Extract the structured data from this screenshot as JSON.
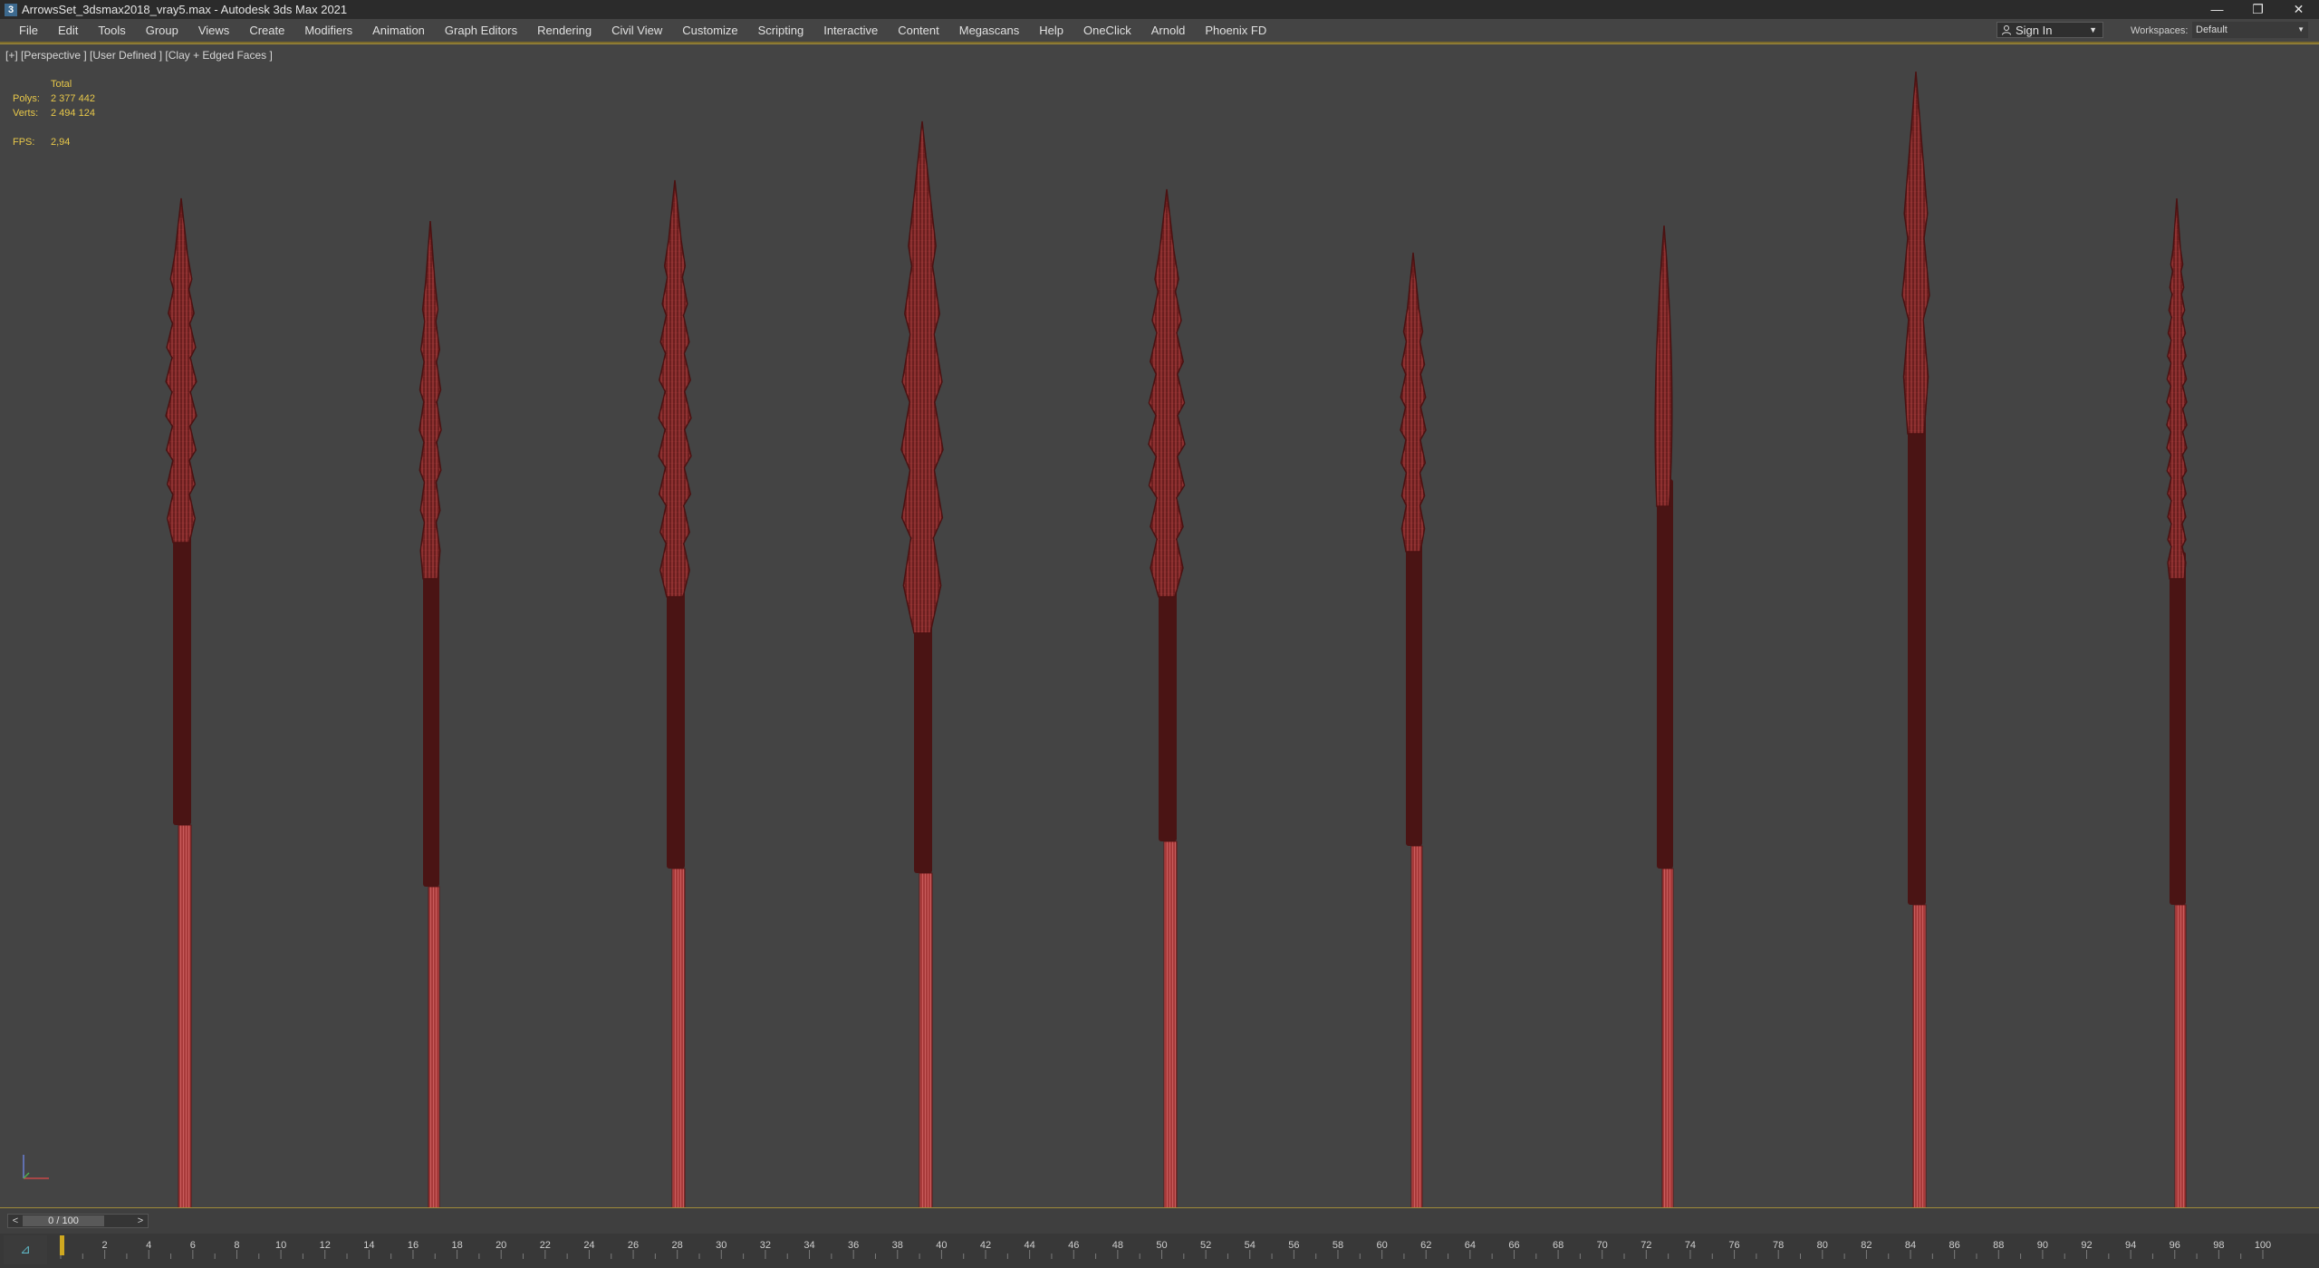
{
  "window": {
    "title": "ArrowsSet_3dsmax2018_vray5.max - Autodesk 3ds Max 2021",
    "icon": "3",
    "controls": [
      "minimize-icon",
      "restore-icon",
      "close-icon"
    ],
    "control_glyphs": {
      "minimize": "—",
      "restore": "❐",
      "close": "✕"
    }
  },
  "menu": [
    "File",
    "Edit",
    "Tools",
    "Group",
    "Views",
    "Create",
    "Modifiers",
    "Animation",
    "Graph Editors",
    "Rendering",
    "Civil View",
    "Customize",
    "Scripting",
    "Interactive",
    "Content",
    "Megascans",
    "Help",
    "OneClick",
    "Arnold",
    "Phoenix FD"
  ],
  "signin": {
    "icon": "user-icon",
    "label": "Sign In"
  },
  "workspaces": {
    "label": "Workspaces:",
    "value": "Default"
  },
  "viewport": {
    "label": "[+] [Perspective ] [User Defined ] [Clay + Edged Faces ]",
    "stats": {
      "header": "Total",
      "polys_label": "Polys:",
      "polys": "2 377 442",
      "verts_label": "Verts:",
      "verts": "2 494 124",
      "fps_label": "FPS:",
      "fps": "2,94"
    },
    "object_color": "#6b1f1f",
    "wire_color": "#c14a4a",
    "arrow_count": 9
  },
  "timeline": {
    "slider_label": "0 / 100",
    "prev": "<",
    "next": ">",
    "ticks": [
      "2",
      "4",
      "6",
      "8",
      "10",
      "12",
      "14",
      "16",
      "18",
      "20",
      "22",
      "24",
      "26",
      "28",
      "30",
      "32",
      "34",
      "36",
      "38",
      "40",
      "42",
      "44",
      "46",
      "48",
      "50",
      "52",
      "54",
      "56",
      "58",
      "60",
      "62",
      "64",
      "66",
      "68",
      "70",
      "72",
      "74",
      "76",
      "78",
      "80",
      "82",
      "84",
      "86",
      "88",
      "90",
      "92",
      "94",
      "96",
      "98",
      "100"
    ],
    "current_frame": 0,
    "track_icon": "track-view-icon"
  },
  "colors": {
    "accent": "#a08b3a",
    "stats": "#e8c84a",
    "background": "#444444"
  }
}
